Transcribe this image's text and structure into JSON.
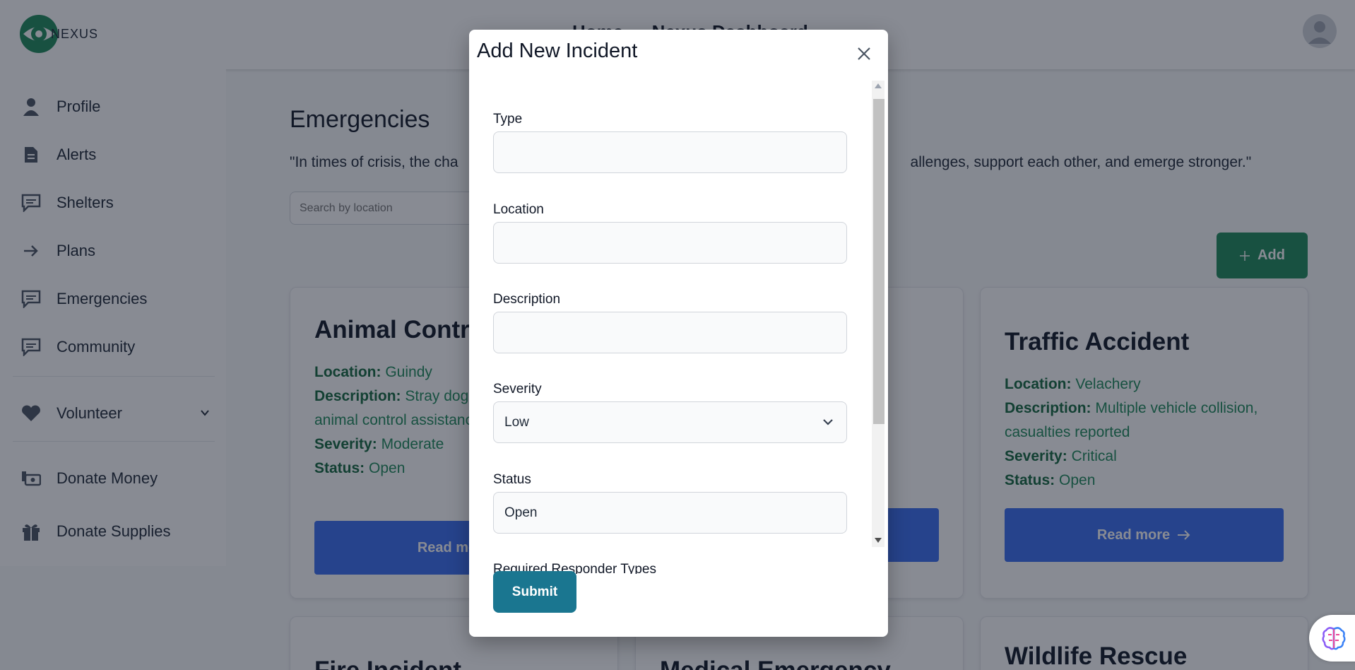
{
  "header": {
    "logo_text": "NEXUS",
    "title": "Home — Nexus Dashboard"
  },
  "sidebar": {
    "items": [
      {
        "label": "Profile",
        "icon": "person-icon"
      },
      {
        "label": "Alerts",
        "icon": "document-icon"
      },
      {
        "label": "Shelters",
        "icon": "chat-icon"
      },
      {
        "label": "Plans",
        "icon": "arrow-right-icon"
      },
      {
        "label": "Emergencies",
        "icon": "chat-icon"
      },
      {
        "label": "Community",
        "icon": "chat-icon"
      },
      {
        "label": "Volunteer",
        "icon": "heart-icon"
      },
      {
        "label": "Donate Money",
        "icon": "money-icon"
      },
      {
        "label": "Donate Supplies",
        "icon": "gift-icon"
      }
    ]
  },
  "main": {
    "title": "Emergencies",
    "quote_start": "\"In times of crisis, the cha",
    "quote_end": "allenges, support each other, and emerge stronger.\"",
    "search_placeholder": "Search by location",
    "add_label": "Add",
    "read_more_label": "Read more",
    "location_label": "Location:",
    "description_label": "Description:",
    "severity_label": "Severity:",
    "status_label": "Status:",
    "cards": [
      {
        "title": "Animal Control",
        "location": "Guindy",
        "description": "Stray dog disturbance, need animal control assistance",
        "severity": "Moderate",
        "status": "Open"
      },
      {
        "title": "Traffic Accident",
        "location": "Velachery",
        "description": "Multiple vehicle collision, casualties reported",
        "severity": "Critical",
        "status": "Open"
      }
    ],
    "bottom_cards": [
      "Fire Incident",
      "Medical Emergency",
      "Wildlife Rescue"
    ]
  },
  "modal": {
    "title": "Add New Incident",
    "fields": {
      "type_label": "Type",
      "type_value": "",
      "location_label": "Location",
      "location_value": "",
      "description_label": "Description",
      "description_value": "",
      "severity_label": "Severity",
      "severity_value": "Low",
      "status_label": "Status",
      "status_value": "Open",
      "responders_label": "Required Responder Types"
    },
    "submit_label": "Submit"
  },
  "colors": {
    "primary_green": "#1f8a5b",
    "read_more_blue": "#3b6ef0",
    "submit_teal": "#1a7690"
  }
}
